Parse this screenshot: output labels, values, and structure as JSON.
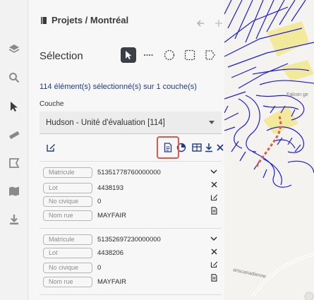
{
  "header": {
    "title": "Projets / Montréal"
  },
  "selection": {
    "label": "Sélection",
    "tools": [
      {
        "name": "pointer-tool"
      },
      {
        "name": "line-tool"
      },
      {
        "name": "circle-tool"
      },
      {
        "name": "rectangle-tool"
      },
      {
        "name": "polygon-tool"
      }
    ],
    "count_text": "114 élément(s) sélectionné(s) sur 1 couche(s)"
  },
  "layer": {
    "label": "Couche",
    "selected": "Hudson - Unité d'évaluation [114]"
  },
  "records": [
    {
      "fields": [
        {
          "label": "Matricule",
          "value": "51351778760000000"
        },
        {
          "label": "Lot",
          "value": "4438193"
        },
        {
          "label": "No civique",
          "value": "0"
        },
        {
          "label": "Nom rue",
          "value": "MAYFAIR"
        }
      ]
    },
    {
      "fields": [
        {
          "label": "Matricule",
          "value": "51352697230000000"
        },
        {
          "label": "Lot",
          "value": "4438206"
        },
        {
          "label": "No civique",
          "value": "0"
        },
        {
          "label": "Nom rue",
          "value": "MAYFAIR"
        }
      ]
    }
  ],
  "map": {
    "labels": {
      "place": "Falcon ge",
      "road": "anscanadienne"
    }
  },
  "colors": {
    "accent": "#1f3b8f",
    "highlight": "#e2584a",
    "selection_road": "#e2584a",
    "parcel": "#1a1ae6"
  }
}
